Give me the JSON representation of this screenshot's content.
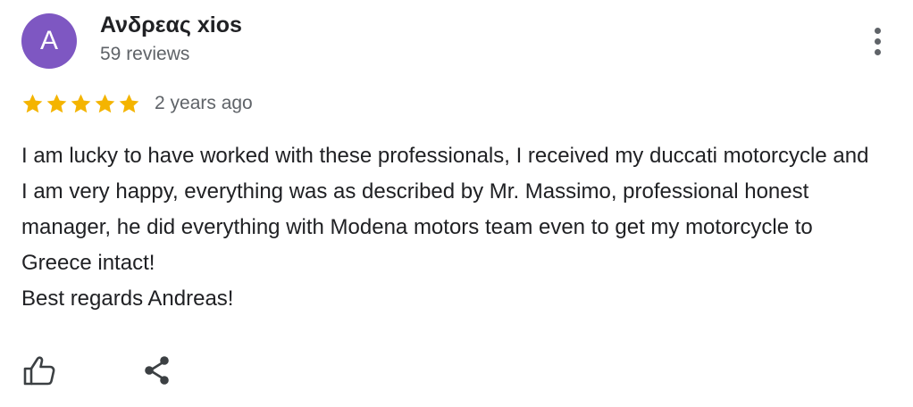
{
  "reviewer": {
    "avatar_letter": "A",
    "avatar_color": "#7e57c2",
    "name": "Ανδρεας xios",
    "review_count": "59 reviews"
  },
  "review": {
    "rating": 5,
    "rating_max": 5,
    "star_color": "#f4b400",
    "date": "2 years ago",
    "text_lines": [
      "I am lucky to have worked with these professionals, I received my duccati motorcycle and I am very happy, everything was as described by Mr. Massimo, professional honest manager, he did everything with Modena motors team even to get my motorcycle to Greece intact!",
      "Best regards Andreas!"
    ]
  },
  "icons": {
    "more": "more-vertical-icon",
    "like": "thumbs-up-icon",
    "share": "share-icon"
  }
}
